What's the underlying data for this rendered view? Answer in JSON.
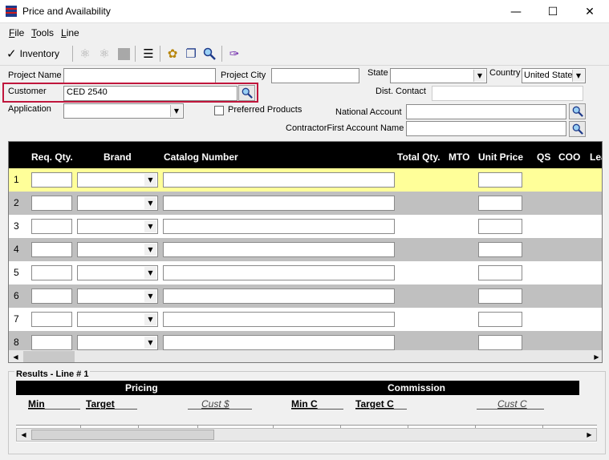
{
  "window": {
    "title": "Price and Availability",
    "minimize": "—",
    "maximize": "☐",
    "close": "✕"
  },
  "menu": {
    "file": "File",
    "tools": "Tools",
    "line": "Line"
  },
  "toolbar": {
    "inventory_label": "Inventory"
  },
  "form": {
    "project_name_label": "Project Name",
    "project_name_value": "",
    "project_city_label": "Project City",
    "project_city_value": "",
    "state_label": "State",
    "state_value": "",
    "country_label": "Country",
    "country_value": "United State",
    "customer_label": "Customer",
    "customer_value": "CED 2540",
    "dist_contact_label": "Dist. Contact",
    "dist_contact_value": "",
    "application_label": "Application",
    "application_value": "",
    "preferred_products_label": "Preferred Products",
    "preferred_products_checked": false,
    "national_account_label": "National Account",
    "national_account_value": "",
    "contractor_label": "ContractorFirst Account Name",
    "contractor_value": ""
  },
  "grid": {
    "columns": [
      "Req. Qty.",
      "Brand",
      "Catalog Number",
      "Total Qty.",
      "MTO",
      "Unit Price",
      "QS",
      "COO",
      "Lea"
    ],
    "rows": [
      {
        "num": "1",
        "highlight": "#ffff99"
      },
      {
        "num": "2",
        "highlight": "#c0c0c0"
      },
      {
        "num": "3",
        "highlight": "#ffffff"
      },
      {
        "num": "4",
        "highlight": "#c0c0c0"
      },
      {
        "num": "5",
        "highlight": "#ffffff"
      },
      {
        "num": "6",
        "highlight": "#c0c0c0"
      },
      {
        "num": "7",
        "highlight": "#ffffff"
      },
      {
        "num": "8",
        "highlight": "#c0c0c0"
      }
    ]
  },
  "results": {
    "title": "Results - Line # 1",
    "pricing_label": "Pricing",
    "commission_label": "Commission",
    "cols": {
      "min": "Min",
      "target": "Target",
      "cust_dollar": "Cust $",
      "min_c": "Min C",
      "target_c": "Target C",
      "cust_c": "Cust C"
    }
  },
  "colors": {
    "highlight_border": "#c0163c",
    "row_selected": "#ffff99",
    "row_alt": "#c0c0c0"
  }
}
